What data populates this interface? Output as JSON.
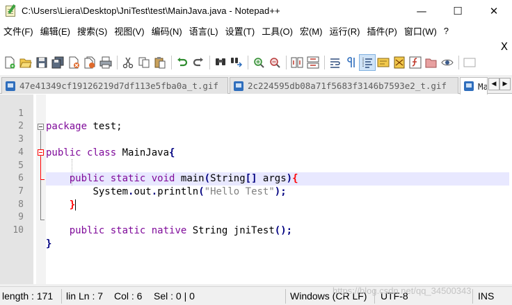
{
  "window": {
    "title": "C:\\Users\\Liera\\Desktop\\JniTest\\test\\MainJava.java - Notepad++",
    "minimize": "—",
    "maximize": "☐",
    "close": "✕"
  },
  "menu": {
    "items": [
      "文件(F)",
      "编辑(E)",
      "搜索(S)",
      "视图(V)",
      "编码(N)",
      "语言(L)",
      "设置(T)",
      "工具(O)",
      "宏(M)",
      "运行(R)",
      "插件(P)",
      "窗口(W)",
      "?"
    ],
    "close_doc": "X"
  },
  "tabs": [
    {
      "label": "47e41349cf19126219d7df113e5fba0a_t.gif",
      "active": false
    },
    {
      "label": "2c224595db08a71f5683f3146b7593e2_t.gif",
      "active": false
    },
    {
      "label": "Ma",
      "active": true
    }
  ],
  "tab_scroll": {
    "left": "◀",
    "right": "▶"
  },
  "editor": {
    "line_numbers": [
      "1",
      "2",
      "3",
      "4",
      "5",
      "6",
      "7",
      "8",
      "9",
      "10"
    ],
    "current_line": 7,
    "lines": {
      "l1": {
        "kw": "package",
        "rest": " test;"
      },
      "l3": {
        "kw": "public",
        "kw2": "class",
        "name": " MainJava",
        "brace": "{"
      },
      "l5": {
        "kw_a": "public",
        "kw_b": "static",
        "kw_c": "void",
        "name": " main",
        "open": "(",
        "type": "String",
        "arr": "[]",
        "arg": " args",
        "close": ")",
        "brace": "{"
      },
      "l6": {
        "obj": "System",
        "dot1": ".",
        "field": "out",
        "dot2": ".",
        "method": "println",
        "open": "(",
        "str": "\"Hello Test\"",
        "close": ")",
        "semi": ";"
      },
      "l7": {
        "brace": "}"
      },
      "l9": {
        "kw_a": "public",
        "kw_b": "static",
        "kw_c": "native",
        "type": " String",
        "name": " jniTest",
        "parens": "()",
        "semi": ";"
      },
      "l10": {
        "brace": "}"
      }
    }
  },
  "status": {
    "length": "length : 171",
    "lines_trunc": "lin",
    "ln": "Ln : 7",
    "col": "Col : 6",
    "sel": "Sel : 0 | 0",
    "eol": "Windows (CR LF)",
    "encoding": "UTF-8",
    "mode": "INS",
    "watermark": "https://blog.csdn.net/qq_34500343"
  },
  "colors": {
    "keyword": "#7f0a9a",
    "keyword_blue": "#0000ff",
    "string": "#808080",
    "current_line": "#e8e8ff",
    "brace_match": "#ff0000"
  }
}
